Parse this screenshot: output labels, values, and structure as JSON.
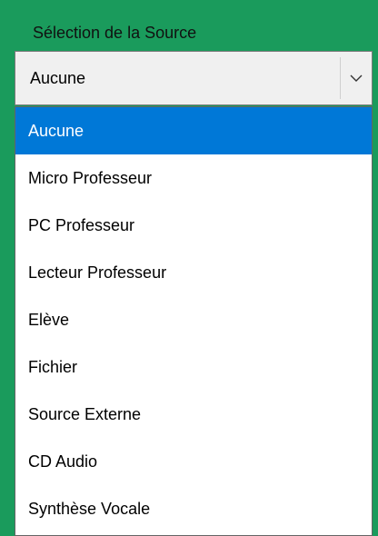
{
  "group": {
    "label": "Sélection de la Source"
  },
  "combo": {
    "value": "Aucune",
    "arrow_icon": "chevron-down-icon"
  },
  "dropdown": {
    "selected_index": 0,
    "items": [
      {
        "label": "Aucune"
      },
      {
        "label": "Micro Professeur"
      },
      {
        "label": "PC Professeur"
      },
      {
        "label": "Lecteur Professeur"
      },
      {
        "label": "Elève"
      },
      {
        "label": "Fichier"
      },
      {
        "label": "Source Externe"
      },
      {
        "label": "CD Audio"
      },
      {
        "label": "Synthèse Vocale"
      }
    ]
  },
  "colors": {
    "panel_background": "#1a9b5c",
    "selection": "#0078d7",
    "combo_background": "#f0f0f0"
  }
}
